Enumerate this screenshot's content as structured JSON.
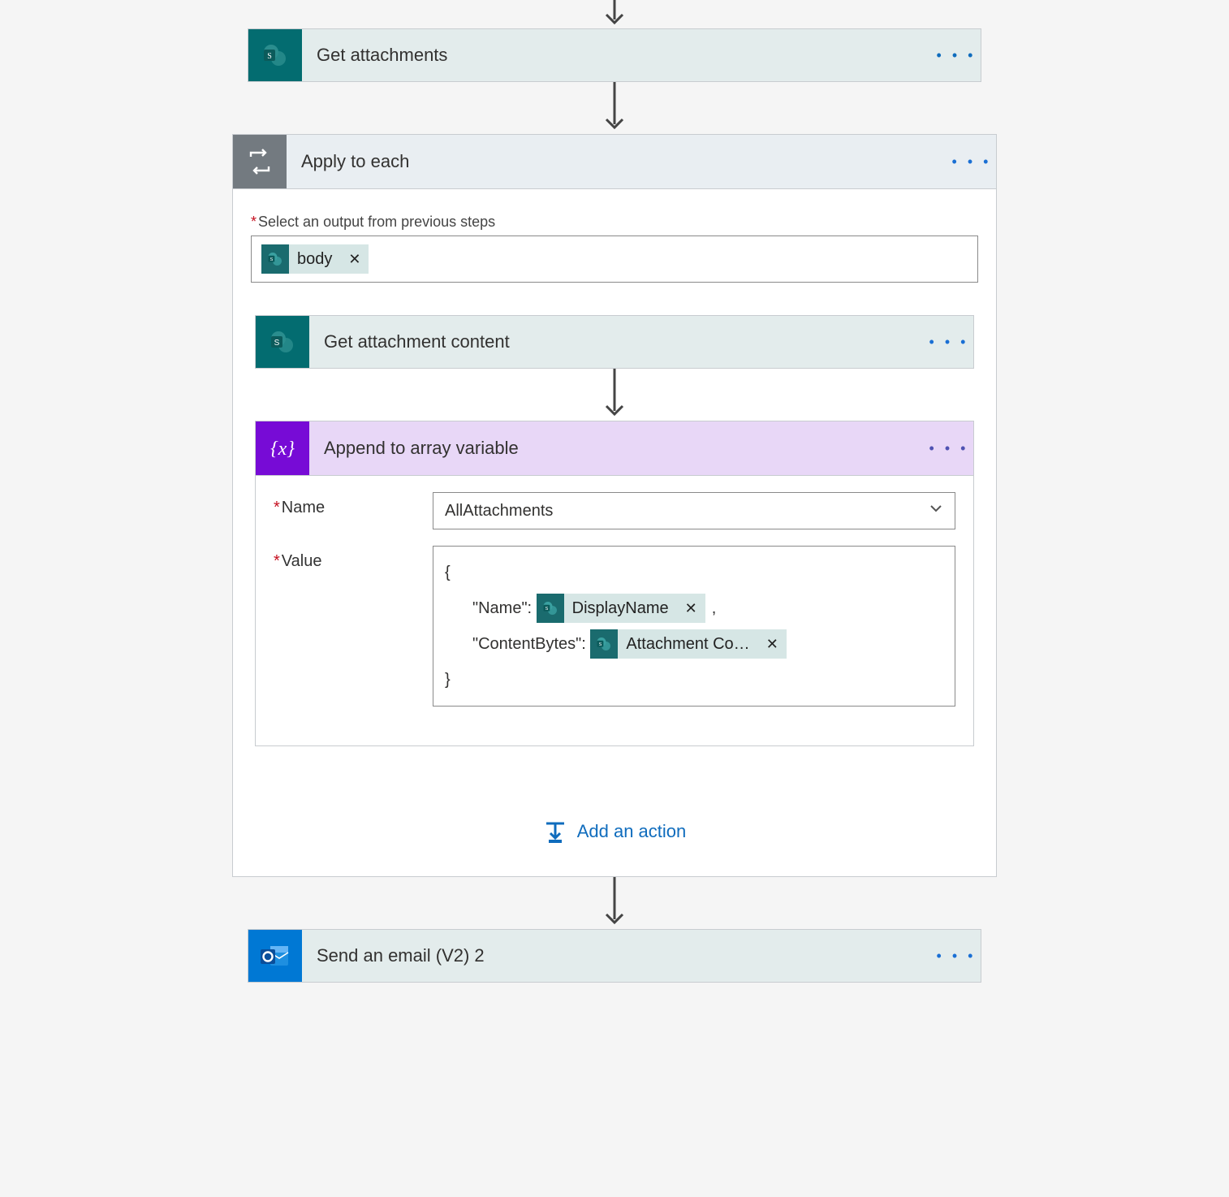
{
  "steps": {
    "get_attachments": {
      "title": "Get attachments"
    },
    "apply_to_each": {
      "title": "Apply to each",
      "select_label": "Select an output from previous steps",
      "select_token": "body",
      "get_attachment_content": {
        "title": "Get attachment content"
      },
      "append_array": {
        "title": "Append to array variable",
        "name_label": "Name",
        "name_value": "AllAttachments",
        "value_label": "Value",
        "json": {
          "open": "{",
          "line1_key": "\"Name\": ",
          "line1_token": "DisplayName",
          "line1_after": ",",
          "line2_key": "\"ContentBytes\": ",
          "line2_token": "Attachment Co…",
          "close": "}"
        }
      },
      "add_action_label": "Add an action"
    },
    "send_email": {
      "title": "Send an email (V2) 2"
    }
  }
}
